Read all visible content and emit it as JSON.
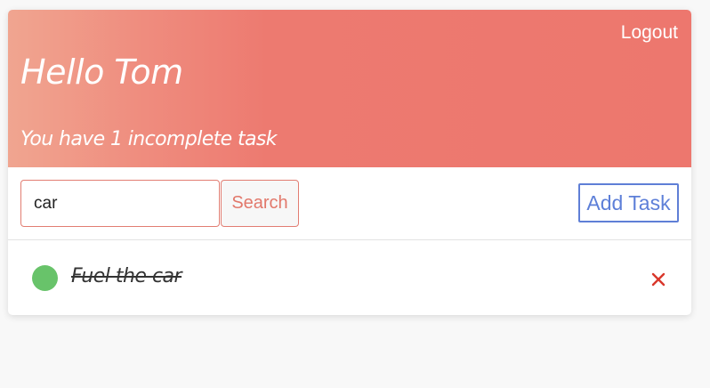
{
  "header": {
    "logout_label": "Logout",
    "greeting": "Hello Tom",
    "subtitle": "You have 1 incomplete task"
  },
  "toolbar": {
    "search_value": "car",
    "search_label": "Search",
    "add_task_label": "Add Task"
  },
  "tasks": [
    {
      "text": "Fuel the car",
      "completed": true,
      "status_icon": "green-dot-icon",
      "delete_icon": "close-icon"
    }
  ],
  "colors": {
    "header_gradient_start": "#f0a590",
    "header_gradient_end": "#ed776e",
    "accent_red": "#e2786b",
    "accent_blue": "#5d7fd8",
    "complete_green": "#68c36a",
    "delete_red": "#d9372b"
  }
}
